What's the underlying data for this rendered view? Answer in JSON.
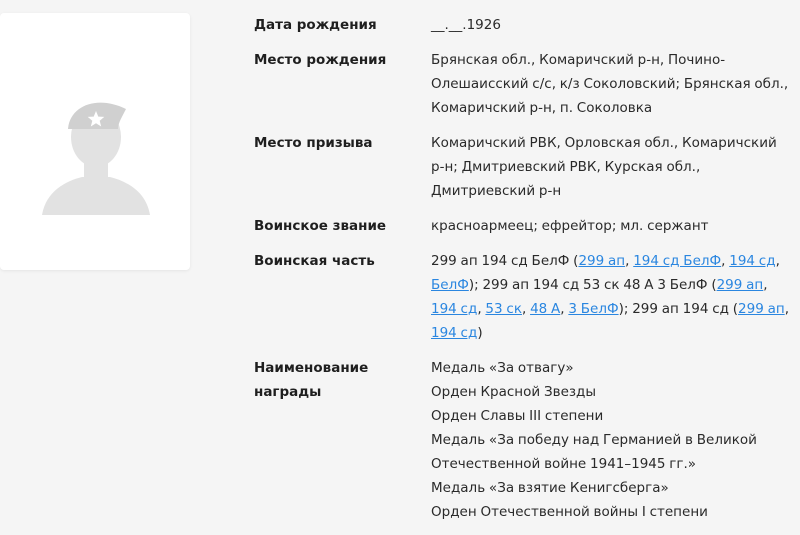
{
  "colors": {
    "link": "#2a86e0",
    "background": "#f5f5f5",
    "card": "#ffffff",
    "silhouette": "#e2e2e2"
  },
  "photo": {
    "icon": "soldier-silhouette-icon"
  },
  "rows": {
    "birth_date": {
      "label": "Дата рождения",
      "value": "__.__.1926"
    },
    "birth_place": {
      "label": "Место рождения",
      "value": "Брянская обл., Комаричский р-н, Почино-Олешаисский с/с, к/з Соколовский; Брянская обл., Комаричский р-н, п. Соколовка"
    },
    "draft_place": {
      "label": "Место призыва",
      "value": "Комаричский РВК, Орловская обл., Комаричский р-н; Дмитриевский РВК, Курская обл., Дмитриевский р-н"
    },
    "rank": {
      "label": "Воинское звание",
      "value": "красноармеец; ефрейтор; мл. сержант"
    },
    "unit": {
      "label": "Воинская часть",
      "u1_text": "299 ап 194 сд БелФ (",
      "u1_links": [
        "299 ап",
        "194 сд БелФ",
        "194 сд",
        "БелФ"
      ],
      "u1_close": "); ",
      "u2_text": "299 ап 194 сд 53 ск 48 А 3 БелФ (",
      "u2_links": [
        "299 ап",
        "194 сд",
        "53 ск",
        "48 А",
        "3 БелФ"
      ],
      "u2_close": "); ",
      "u3_text": "299 ап 194 сд (",
      "u3_links": [
        "299 ап",
        "194 сд"
      ],
      "u3_close": ")",
      "sep": ", "
    },
    "awards": {
      "label_line1": "Наименование",
      "label_line2": "награды",
      "items": [
        "Медаль «За отвагу»",
        "Орден Красной Звезды",
        "Орден Славы III степени",
        "Медаль «За победу над Германией в Великой Отечественной войне 1941–1945 гг.»",
        "Медаль «За взятие Кенигсберга»",
        "Орден Отечественной войны I степени"
      ]
    }
  }
}
